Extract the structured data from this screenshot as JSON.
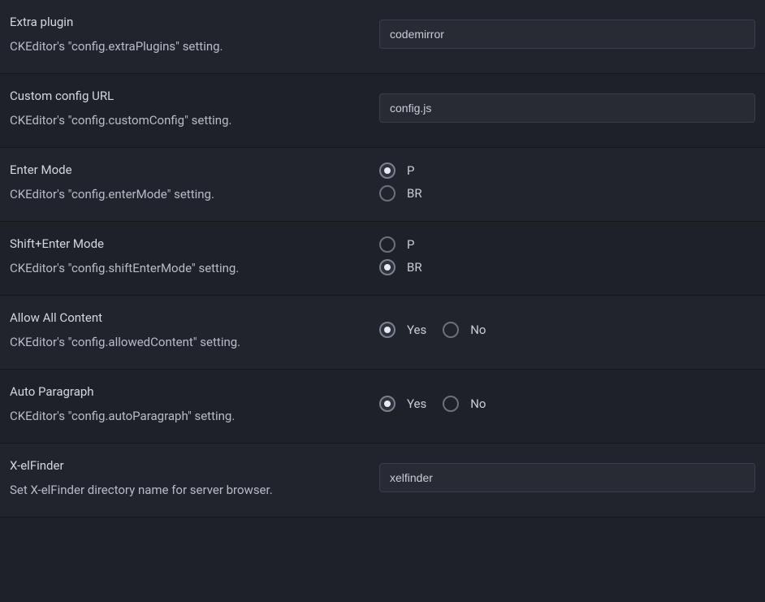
{
  "rows": [
    {
      "id": "extra-plugin",
      "title": "Extra plugin",
      "desc": "CKEditor's \"config.extraPlugins\" setting.",
      "type": "text",
      "value": "codemirror"
    },
    {
      "id": "custom-config-url",
      "title": "Custom config URL",
      "desc": "CKEditor's \"config.customConfig\" setting.",
      "type": "text",
      "value": "config.js"
    },
    {
      "id": "enter-mode",
      "title": "Enter Mode",
      "desc": "CKEditor's \"config.enterMode\" setting.",
      "type": "radio-vertical",
      "options": [
        {
          "label": "P",
          "selected": true
        },
        {
          "label": "BR",
          "selected": false
        }
      ]
    },
    {
      "id": "shift-enter-mode",
      "title": "Shift+Enter Mode",
      "desc": "CKEditor's \"config.shiftEnterMode\" setting.",
      "type": "radio-vertical",
      "options": [
        {
          "label": "P",
          "selected": false
        },
        {
          "label": "BR",
          "selected": true
        }
      ]
    },
    {
      "id": "allow-all-content",
      "title": "Allow All Content",
      "desc": "CKEditor's \"config.allowedContent\" setting.",
      "type": "radio-horizontal",
      "options": [
        {
          "label": "Yes",
          "selected": true
        },
        {
          "label": "No",
          "selected": false
        }
      ]
    },
    {
      "id": "auto-paragraph",
      "title": "Auto Paragraph",
      "desc": "CKEditor's \"config.autoParagraph\" setting.",
      "type": "radio-horizontal",
      "options": [
        {
          "label": "Yes",
          "selected": true
        },
        {
          "label": "No",
          "selected": false
        }
      ]
    },
    {
      "id": "x-elfinder",
      "title": "X-elFinder",
      "desc": "Set X-elFinder directory name for server browser.",
      "type": "text",
      "value": "xelfinder"
    }
  ]
}
